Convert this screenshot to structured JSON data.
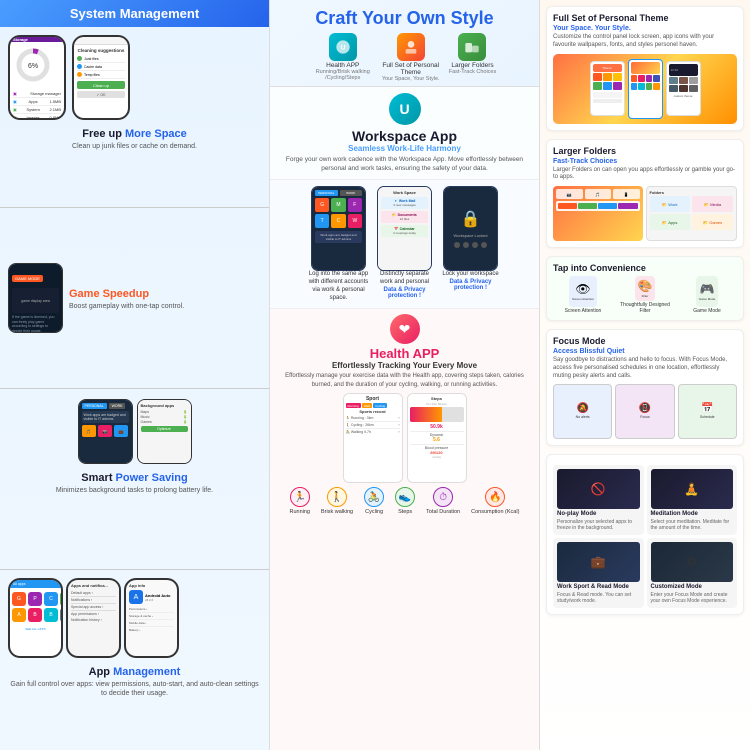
{
  "header": {
    "left_title": "System Management",
    "center_title": "Craft Your Own Style"
  },
  "left_col": {
    "sections": [
      {
        "id": "storage",
        "title_normal": "Free up ",
        "title_highlight": "More Space",
        "desc": "Clean up junk files or cache on demand.",
        "storage_used": "6%",
        "items": [
          "Storage manager",
          "Apps",
          "System",
          "Images"
        ]
      },
      {
        "id": "game",
        "title_normal": "",
        "title_highlight": "Game Speedup",
        "desc": "Boost gameplay with one-tap control."
      },
      {
        "id": "power",
        "title_normal": "Smart ",
        "title_highlight": "Power Saving",
        "desc": "Minimizes background tasks to prolong battery life."
      },
      {
        "id": "apps",
        "title_normal": "App ",
        "title_highlight": "Management",
        "desc": "Gain full control over apps: view permissions, auto-start, and auto-clean settings to decide their usage."
      }
    ]
  },
  "craft_items": [
    {
      "icon_color": "#00bcd4",
      "label": "Health APP",
      "sublabel": "Running/Brisk walking /Cycling/Steps"
    },
    {
      "icon_color": "#ff9800",
      "label": "Full Set of Personal Theme",
      "sublabel": "Your Space, Your Style."
    },
    {
      "icon_color": "#4caf50",
      "label": "Larger Folders",
      "sublabel": "Fast-Track Choices"
    }
  ],
  "workspace": {
    "logo_char": "U",
    "title": "Workspace App",
    "subtitle": "Seamless Work-Life Harmony",
    "desc": "Forge your own work cadence with the Workspace App. Move effortlessly between personal and work tasks, ensuring the safety of your data.",
    "screenshots": [
      {
        "desc": "Log into the same app with different accounts via work & personal space.",
        "link": ""
      },
      {
        "desc": "Distinctly separate work and personal",
        "link": "Data & Privacy protection !"
      },
      {
        "desc": "Lock your workspace",
        "link": "Data & Privacy protection !"
      }
    ]
  },
  "health_app": {
    "title": "Health APP",
    "subtitle": "Effortlessly Tracking Your Every Move",
    "desc": "Effortlessly manage your exercise data with the Health app, covering steps taken, calories burned, and the duration of your cycling, walking, or running activities.",
    "activities": [
      "Running",
      "Brisk walking",
      "Cycling",
      "Steps",
      "Total Duration",
      "Consumption (Kcal)"
    ],
    "metrics": {
      "steps": "50.9k",
      "dynamic": "5.6",
      "blood_pressure": "89/120 mmHg"
    }
  },
  "right_col": {
    "full_set_theme": {
      "title": "Full Set of Personal Theme",
      "subtitle": "Your Space. Your Style.",
      "desc": "Customize the control panel lock screen, app icons with your favourite wallpapers, fonts, and styles personel haven."
    },
    "larger_folders": {
      "title": "Larger Folders",
      "subtitle": "Fast-Track Choices",
      "desc": "Larger Folders on can open you apps effortlessly or gamble your go-to apps."
    },
    "tap_convenience": {
      "title": "Tap into Convenience",
      "items": [
        "Screen Attention",
        "Thoughtfully Designed Filter",
        "Game Mode"
      ]
    },
    "focus_mode": {
      "title": "Focus Mode",
      "subtitle": "Access Blissful Quiet",
      "desc": "Say goodbye to distractions and hello to focus. With Focus Mode, access five personalised schedules in one location, effortlessly muting pesky alerts and calls."
    },
    "modes": [
      {
        "label": "No-play Mode",
        "desc": "Personalize your selected apps to freeze in the background."
      },
      {
        "label": "Meditation Mode",
        "desc": "Select your meditation. Meditate for the amount of the time."
      },
      {
        "label": "Work Sport & Read Mode",
        "desc": "Focus & Read mode. You can set study/work mode."
      },
      {
        "label": "Customized Mode",
        "desc": "Enter your Focus Mode and create your own Focus Mode experience."
      }
    ]
  },
  "colors": {
    "blue": "#2563eb",
    "cyan": "#00bcd4",
    "orange": "#ff9800",
    "green": "#4caf50",
    "pink": "#e91e63",
    "purple": "#9c27b0",
    "teal": "#009688",
    "yellow": "#ffc107",
    "red": "#f44336"
  }
}
